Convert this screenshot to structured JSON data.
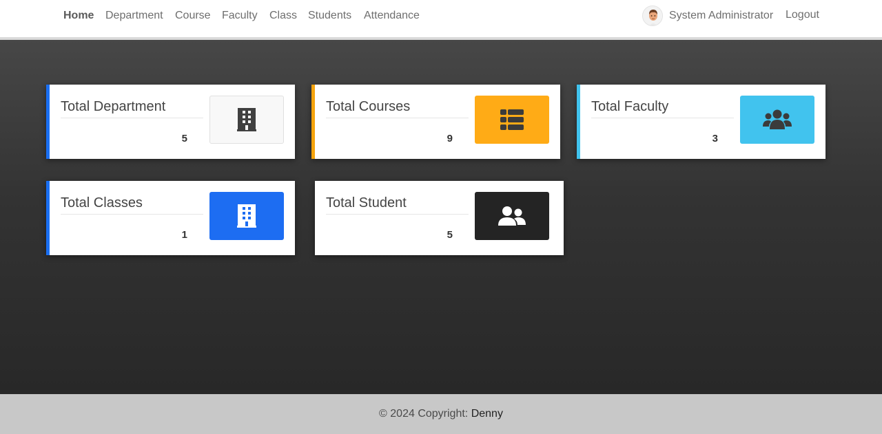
{
  "nav": {
    "items": [
      {
        "label": "Home",
        "active": true
      },
      {
        "label": "Department",
        "active": false
      },
      {
        "label": "Course",
        "active": false
      },
      {
        "label": "Faculty",
        "active": false
      },
      {
        "label": "Class",
        "active": false
      },
      {
        "label": "Students",
        "active": false
      },
      {
        "label": "Attendance",
        "active": false
      }
    ],
    "user_name": "System Administrator",
    "logout_label": "Logout"
  },
  "cards": [
    {
      "title": "Total Department",
      "count": "5",
      "accent": "#1a6ff2",
      "icon": "building-icon",
      "icon_bg": "#f8f8f8",
      "icon_color": "#404040"
    },
    {
      "title": "Total Courses",
      "count": "9",
      "accent": "#f5a40d",
      "icon": "list-icon",
      "icon_bg": "#ffab16",
      "icon_color": "#3b3b3b"
    },
    {
      "title": "Total Faculty",
      "count": "3",
      "accent": "#41c3ee",
      "icon": "users-group-icon",
      "icon_bg": "#41c3ee",
      "icon_color": "#3b3b3b"
    },
    {
      "title": "Total Classes",
      "count": "1",
      "accent": "#1a6ff2",
      "icon": "building-icon",
      "icon_bg": "#1d6df2",
      "icon_color": "#ffffff"
    },
    {
      "title": "Total Student",
      "count": "5",
      "accent": "",
      "icon": "user-friends-icon",
      "icon_bg": "#242424",
      "icon_color": "#ffffff"
    }
  ],
  "footer": {
    "copyright": "© 2024 Copyright:",
    "name": "Denny"
  }
}
